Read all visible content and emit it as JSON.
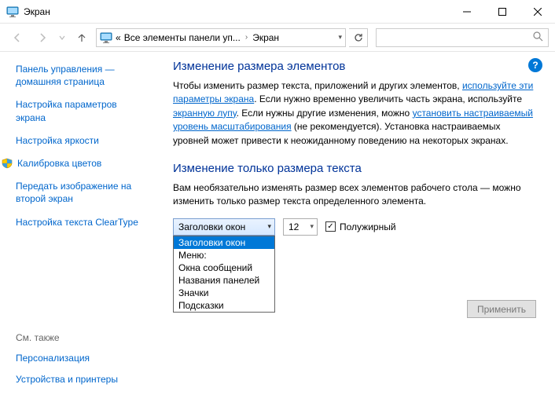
{
  "window": {
    "title": "Экран"
  },
  "nav": {
    "crumb1": "Все элементы панели уп...",
    "crumb2": "Экран"
  },
  "sidebar": {
    "items": [
      "Панель управления — домашняя страница",
      "Настройка параметров экрана",
      "Настройка яркости",
      "Калибровка цветов",
      "Передать изображение на второй экран",
      "Настройка текста ClearType"
    ],
    "see_also_label": "См. также",
    "footer": [
      "Персонализация",
      "Устройства и принтеры"
    ]
  },
  "content": {
    "h1": "Изменение размера элементов",
    "p1_a": "Чтобы изменить размер текста, приложений и других элементов, ",
    "p1_link1": "используйте эти параметры экрана",
    "p1_b": ". Если нужно временно увеличить часть экрана, используйте ",
    "p1_link2": "экранную лупу",
    "p1_c": ". Если нужны другие изменения, можно ",
    "p1_link3": "установить настраиваемый уровень масштабирования",
    "p1_d": " (не рекомендуется). Установка настраиваемых уровней может привести к неожиданному поведению на некоторых экранах.",
    "h2": "Изменение только размера текста",
    "p2": "Вам необязательно изменять размер всех элементов рабочего стола — можно изменить только размер текста определенного элемента.",
    "combo_selected": "Заголовки окон",
    "combo_options": [
      "Заголовки окон",
      "Меню:",
      "Окна сообщений",
      "Названия панелей",
      "Значки",
      "Подсказки"
    ],
    "size_value": "12",
    "bold_label": "Полужирный",
    "apply_label": "Применить"
  }
}
